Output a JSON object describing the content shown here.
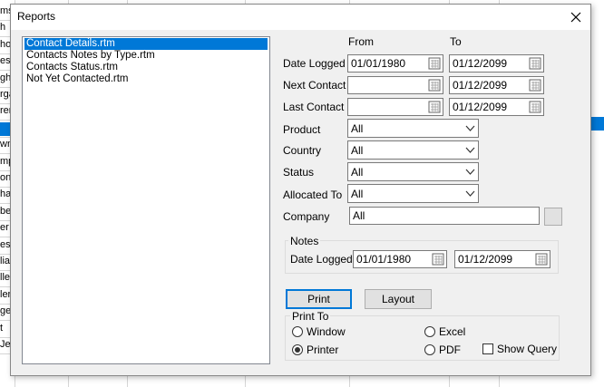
{
  "background_sheet": {
    "row_fragments": [
      "ms",
      "h",
      "hor",
      "es",
      "ght",
      "rga",
      "ren",
      "",
      "wn",
      "mps",
      "on",
      "han",
      "bert",
      "er",
      "es",
      "lia",
      "lle",
      "ler",
      "gers",
      "t",
      "Je"
    ]
  },
  "dialog": {
    "title": "Reports",
    "close_glyph": "✕",
    "report_list": [
      {
        "label": "Contact Details.rtm",
        "selected": true
      },
      {
        "label": "Contacts Notes by Type.rtm",
        "selected": false
      },
      {
        "label": "Contacts Status.rtm",
        "selected": false
      },
      {
        "label": "Not Yet Contacted.rtm",
        "selected": false
      }
    ],
    "headers": {
      "from": "From",
      "to": "To"
    },
    "date_logged": {
      "label": "Date Logged",
      "from": "01/01/1980",
      "to": "01/12/2099"
    },
    "next_contact": {
      "label": "Next Contact",
      "from": "",
      "to": "01/12/2099"
    },
    "last_contact": {
      "label": "Last Contact",
      "from": "",
      "to": "01/12/2099"
    },
    "product": {
      "label": "Product",
      "value": "All"
    },
    "country": {
      "label": "Country",
      "value": "All"
    },
    "status": {
      "label": "Status",
      "value": "All"
    },
    "allocated_to": {
      "label": "Allocated To",
      "value": "All"
    },
    "company": {
      "label": "Company",
      "value": "All"
    },
    "notes": {
      "group_label": "Notes",
      "date_label": "Date Logged",
      "from": "01/01/1980",
      "to": "01/12/2099"
    },
    "buttons": {
      "print": "Print",
      "layout": "Layout"
    },
    "print_to": {
      "group_label": "Print To",
      "window": "Window",
      "printer": "Printer",
      "excel": "Excel",
      "pdf": "PDF",
      "show_query": "Show Query",
      "selected": "printer"
    }
  },
  "colors": {
    "selection": "#0078d7",
    "dialog_bg": "#f0f0f0"
  }
}
